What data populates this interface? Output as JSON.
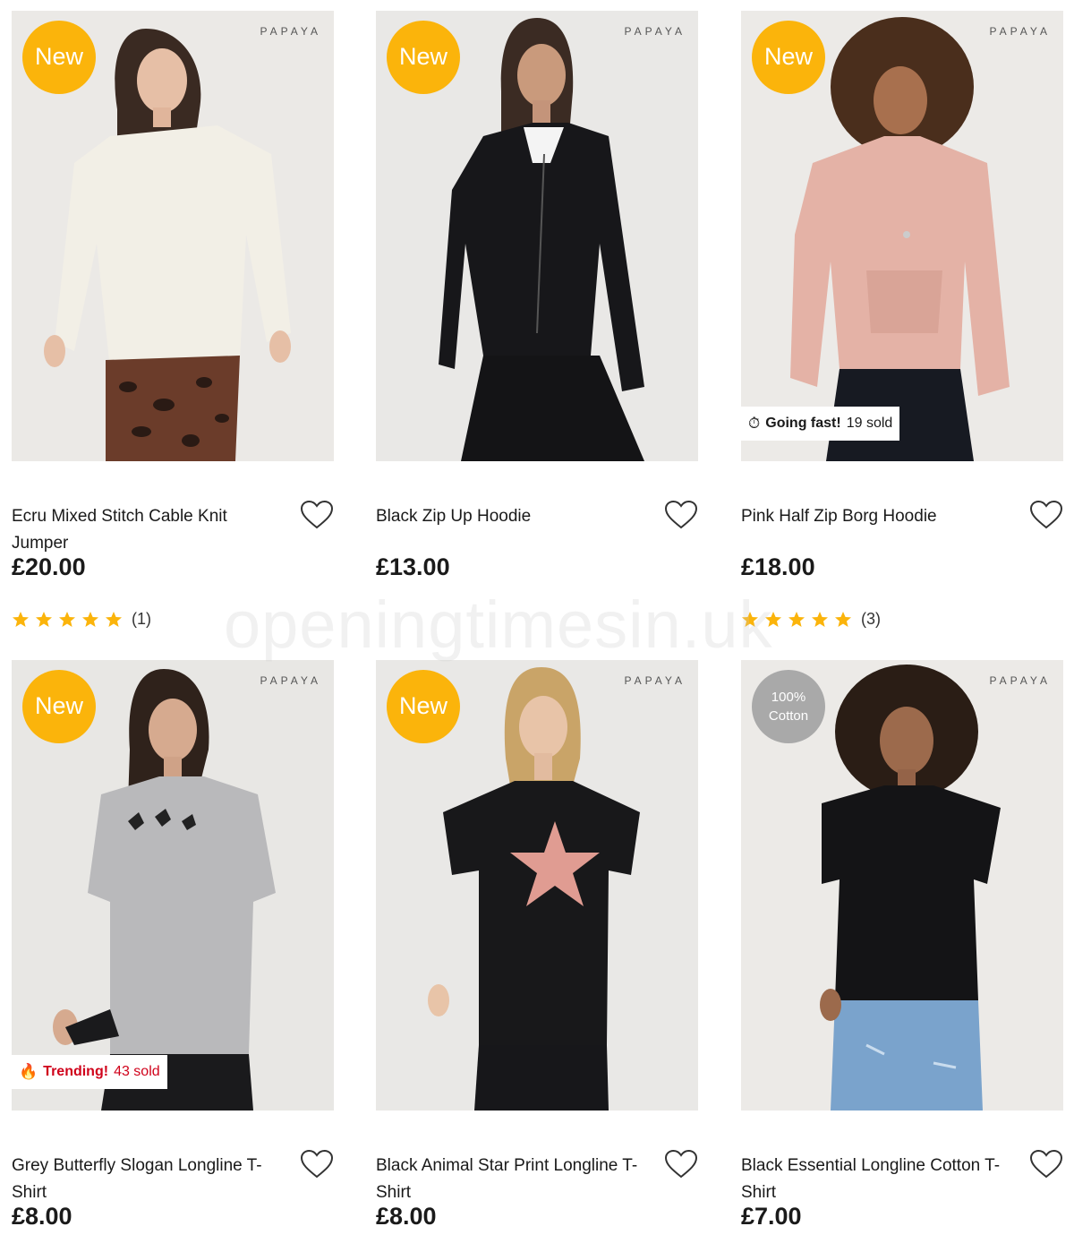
{
  "brand_label": "PAPAYA",
  "products": [
    {
      "name": "Ecru Mixed Stitch Cable Knit Jumper",
      "price": "£20.00",
      "badge": "New",
      "badge_style": "yellow",
      "rating_stars": 5,
      "rating_count": "(1)",
      "image_desc": "woman in ecru cable knit jumper and leopard skirt",
      "tag": null
    },
    {
      "name": "Black Zip Up Hoodie",
      "price": "£13.00",
      "badge": "New",
      "badge_style": "yellow",
      "rating_stars": null,
      "rating_count": null,
      "image_desc": "woman in black zip up hoodie",
      "tag": null
    },
    {
      "name": "Pink Half Zip Borg Hoodie",
      "price": "£18.00",
      "badge": "New",
      "badge_style": "yellow",
      "rating_stars": 5,
      "rating_count": "(3)",
      "image_desc": "woman in pink half zip borg hoodie",
      "tag": {
        "icon": "stopwatch-icon",
        "strong": "Going fast!",
        "count": "19 sold",
        "style": "fast"
      }
    },
    {
      "name": "Grey Butterfly Slogan Longline T-Shirt",
      "price": "£8.00",
      "badge": "New",
      "badge_style": "yellow",
      "rating_stars": null,
      "rating_count": null,
      "image_desc": "woman in grey butterfly longline t-shirt",
      "tag": {
        "icon": "fire-icon",
        "strong": "Trending!",
        "count": "43 sold",
        "style": "trend"
      }
    },
    {
      "name": "Black Animal Star Print Longline T-Shirt",
      "price": "£8.00",
      "badge": "New",
      "badge_style": "yellow",
      "rating_stars": null,
      "rating_count": null,
      "image_desc": "woman in black t-shirt with pink zebra star",
      "tag": null
    },
    {
      "name": "Black Essential Longline Cotton T-Shirt",
      "price": "£7.00",
      "badge": "100%\nCotton",
      "badge_style": "grey",
      "rating_stars": null,
      "rating_count": null,
      "image_desc": "woman in black essential longline t-shirt",
      "tag": null
    }
  ],
  "watermark": "openingtimesin.uk",
  "colors": {
    "badge_yellow": "#fbb40b",
    "badge_grey": "#a9a9a9",
    "star": "#fbb40b",
    "trending_red": "#d0021b"
  }
}
